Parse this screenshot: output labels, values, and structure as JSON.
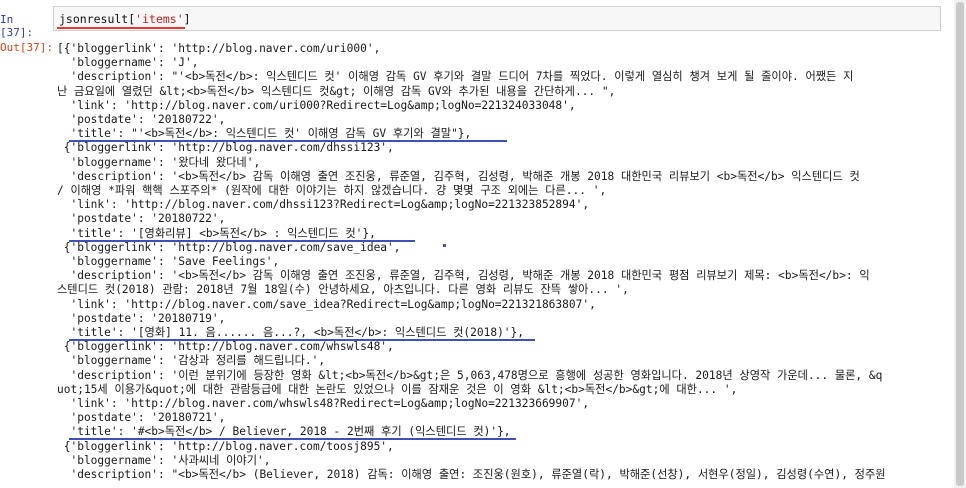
{
  "cell": {
    "in_prompt": "In [37]:",
    "out_prompt": "Out[37]:",
    "code_prefix": "jsonresult[",
    "code_string": "'items'",
    "code_suffix": "]"
  },
  "output_lines": [
    "[{'bloggerlink': 'http://blog.naver.com/uri000',",
    "  'bloggername': 'J',",
    "  'description': \"'<b>독전</b>: 익스텐디드 컷' 이해영 감독 GV 후기와 결말 드디어 7차를 찍었다. 이렇게 열심히 챙겨 보게 될 줄이야. 어쨌든 지",
    "난 금요일에 열렸던 &lt;<b>독전</b> 익스텐디드 컷&gt; 이해영 감독 GV와 추가된 내용을 간단하게... \",",
    "  'link': 'http://blog.naver.com/uri000?Redirect=Log&amp;logNo=221324033048',",
    "  'postdate': '20180722',",
    "  'title': \"'<b>독전</b>: 익스텐디드 컷' 이해영 감독 GV 후기와 결말\"},",
    " {'bloggerlink': 'http://blog.naver.com/dhssi123',",
    "  'bloggername': '왔다네 왔다네',",
    "  'description': '<b>독전</b> 감독 이해영 출연 조진웅, 류준열, 김주혁, 김성령, 박해준 개봉 2018 대한민국 리뷰보기 <b>독전</b> 익스텐디드 컷",
    "/ 이해영 *파워 핵핵 스포주의* (원작에 대한 이야기는 하지 않겠습니다. 걍 몇몇 구조 외에는 다른... ',",
    "  'link': 'http://blog.naver.com/dhssi123?Redirect=Log&amp;logNo=221323852894',",
    "  'postdate': '20180722',",
    "  'title': '[영화리뷰] <b>독전</b> : 익스텐디드 컷'},",
    " {'bloggerlink': 'http://blog.naver.com/save_idea',",
    "  'bloggername': 'Save Feelings',",
    "  'description': '<b>독전</b> 감독 이해영 출연 조진웅, 류준열, 김주혁, 김성령, 박해준 개봉 2018 대한민국 평점 리뷰보기 제목: <b>독전</b>: 익",
    "스텐디드 컷(2018) 관람: 2018년 7월 18일(수) 안녕하세요, 아츠입니다. 다른 영화 리뷰도 잔뜩 쌓아... ',",
    "  'link': 'http://blog.naver.com/save_idea?Redirect=Log&amp;logNo=221321863807',",
    "  'postdate': '20180719',",
    "  'title': '[영화] 11. 음...... 음...?, <b>독전</b>: 익스텐디드 컷(2018)'},",
    " {'bloggerlink': 'http://blog.naver.com/whswls48',",
    "  'bloggername': '감상과 정리를 해드립니다.',",
    "  'description': '이런 분위기에 등장한 영화 &lt;<b>독전</b>&gt;은 5,063,478명으로 흥행에 성공한 영화입니다. 2018년 상영작 가운데... 물론, &q",
    "uot;15세 이용가&quot;에 대한 관람등급에 대한 논란도 있었으나 이를 잠재운 것은 이 영화 &lt;<b>독전</b>&gt;에 대한... ',",
    "  'link': 'http://blog.naver.com/whswls48?Redirect=Log&amp;logNo=221323669907',",
    "  'postdate': '20180721',",
    "  'title': '#<b>독전</b> / Believer, 2018 - 2번째 후기 (익스텐디드 컷)'},",
    " {'bloggerlink': 'http://blog.naver.com/toosj895',",
    "  'bloggername': '사과씨네 이야기',",
    "  'description': \"<b>독전</b> (Believer, 2018) 감독: 이해영 출연: 조진웅(원호), 류준열(락), 박해준(선창), 서현우(정일), 김성령(수연), 정주원"
  ]
}
